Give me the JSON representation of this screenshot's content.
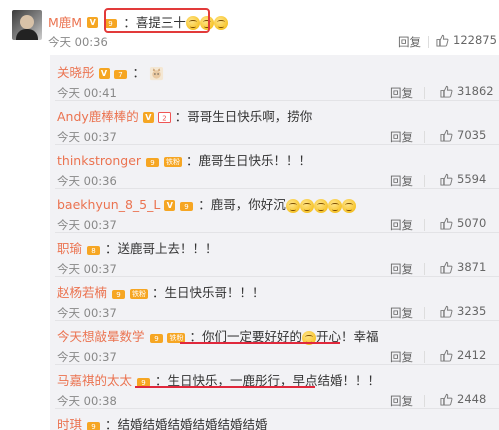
{
  "main": {
    "author": "M鹿M",
    "text": "喜提三十",
    "time": "今天 00:36",
    "reply_label": "回复",
    "likes": "122875"
  },
  "replies": [
    {
      "author": "关晓彤",
      "text": "",
      "time": "今天 00:41",
      "reply_label": "回复",
      "likes": "31862"
    },
    {
      "author": "Andy鹿棒棒的",
      "text": "哥哥生日快乐啊，捞你",
      "time": "今天 00:37",
      "reply_label": "回复",
      "likes": "7035"
    },
    {
      "author": "thinkstronger",
      "text": "鹿哥生日快乐！！！",
      "time": "今天 00:36",
      "reply_label": "回复",
      "likes": "5594"
    },
    {
      "author": "baekhyun_8_5_L",
      "text": "鹿哥，你好沉",
      "time": "今天 00:37",
      "reply_label": "回复",
      "likes": "5070"
    },
    {
      "author": "职瑜",
      "text": "送鹿哥上去！！！",
      "time": "今天 00:37",
      "reply_label": "回复",
      "likes": "3871"
    },
    {
      "author": "赵杨若楠",
      "text": "生日快乐哥！！！",
      "time": "今天 00:37",
      "reply_label": "回复",
      "likes": "3235"
    },
    {
      "author": "今天想敲晕数学",
      "text_a": "你们一定要好好的",
      "text_b": "开心！幸福",
      "time": "今天 00:37",
      "reply_label": "回复",
      "likes": "2412"
    },
    {
      "author": "马嘉祺的太太",
      "text": "生日快乐，一鹿彤行，早点结婚！！！",
      "time": "今天 00:38",
      "reply_label": "回复",
      "likes": "2448"
    },
    {
      "author": "时琪",
      "text": "结婚结婚结婚结婚结婚结婚"
    }
  ],
  "badges": {
    "vip": "铁粉"
  },
  "colors": {
    "accent": "#eb7350",
    "highlight": "#e0283c",
    "panel": "#f2f2f5"
  }
}
